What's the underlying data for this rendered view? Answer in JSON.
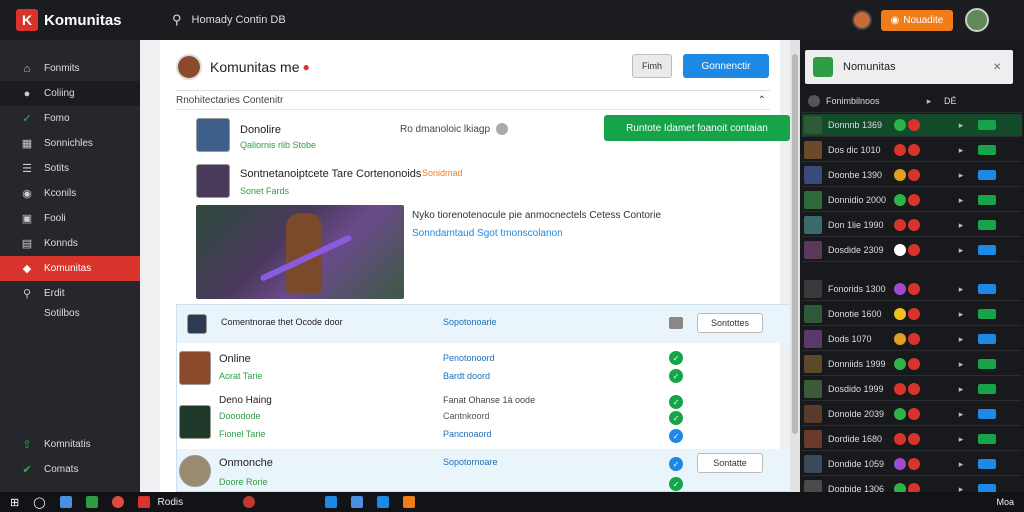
{
  "app": {
    "brand": "Komunitas",
    "search_text": "Homady Contin DB",
    "notify_label": "Nouadite"
  },
  "sidebar": {
    "items": [
      {
        "icon": "home-icon",
        "label": "Fonmits"
      },
      {
        "icon": "controller-icon",
        "label": "Coliing"
      },
      {
        "icon": "check-icon",
        "label": "Fomo"
      },
      {
        "icon": "grid-icon",
        "label": "Sonnichles"
      },
      {
        "icon": "list-icon",
        "label": "Sotits"
      },
      {
        "icon": "location-icon",
        "label": "Kconils"
      },
      {
        "icon": "bag-icon",
        "label": "Fooli"
      },
      {
        "icon": "calendar-icon",
        "label": "Konnds"
      },
      {
        "icon": "community-icon",
        "label": "Komunitas"
      },
      {
        "icon": "pin-icon",
        "label": "Erdit"
      },
      {
        "icon": "",
        "label": "Sotilbos"
      }
    ],
    "bottom": [
      {
        "icon": "up-arrow-icon",
        "label": "Komnitatis"
      },
      {
        "icon": "check-circle-icon",
        "label": "Comats"
      }
    ]
  },
  "main": {
    "header_title": "Komunitas me",
    "grey_button": "Fimh",
    "blue_button": "Gonnenctir",
    "section_title": "Rnohitectaries Contenitr",
    "row1": {
      "name": "Donolire",
      "sub": "Qaliornis rlib Stobe",
      "mid": "Ro dmanoloic lkiagp",
      "action": "Runtote Idamet foanoit contaian"
    },
    "row2": {
      "title": "Sontnetanoiptcete Tare Cortenonoids",
      "accent": "Sonidmad",
      "sub": "Sonet Fards"
    },
    "post": {
      "desc": "Nyko tiorenotenocule pie anmocnectels Cetess Contorie",
      "link": "Sonndamtaud Sgot tmonscolanon"
    },
    "list": [
      {
        "name": "Comentnorae thet Ocode door",
        "col": "Sopotonoarie",
        "button": "Sontottes"
      },
      {
        "name": "Online",
        "sub": "Aorat Tarie",
        "col": "Penotonoord",
        "col2": "Bardt doord"
      },
      {
        "name": "Deno Haing",
        "sub": "Dooodode",
        "sub2": "Fionel Tarie",
        "col": "Fanat Ohanse 1ä oode",
        "col2": "Cantnkoord",
        "col3": "Pancnoaord"
      },
      {
        "name": "Onmonche",
        "sub": "Doore Rorie",
        "col": "Sopotornoare",
        "button": "Sontatte"
      }
    ]
  },
  "right_panel": {
    "title": "Nomunitas",
    "header_row": {
      "name": "Fonimbilnoos",
      "value": "DÉ"
    },
    "rows": [
      {
        "name": "Donnnb 1369",
        "badge": "green",
        "highlight": true
      },
      {
        "name": "Dos dic 1010",
        "badge": "green"
      },
      {
        "name": "Doonbe 1390",
        "badge": "blue"
      },
      {
        "name": "Donnidio 2000",
        "badge": "green"
      },
      {
        "name": "Don 1lie 1990",
        "badge": "green"
      },
      {
        "name": "Dosdide 2309",
        "badge": "blue"
      },
      {
        "name": "Fonorids 1300",
        "badge": "blue"
      },
      {
        "name": "Donotie 1600",
        "badge": "green"
      },
      {
        "name": "Dods 1070",
        "badge": "blue"
      },
      {
        "name": "Donniids 1999",
        "badge": "green"
      },
      {
        "name": "Dosdido 1999",
        "badge": "green"
      },
      {
        "name": "Donolde 2039",
        "badge": "blue"
      },
      {
        "name": "Dordide 1680",
        "badge": "green"
      },
      {
        "name": "Dondide 1059",
        "badge": "blue"
      },
      {
        "name": "Dogbide 1306",
        "badge": "blue"
      }
    ]
  },
  "taskbar": {
    "label": "Rodis",
    "time": "Moa"
  }
}
